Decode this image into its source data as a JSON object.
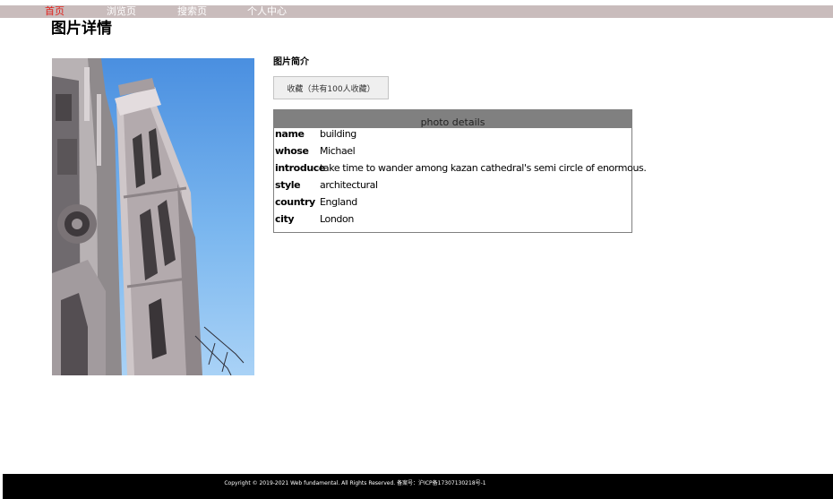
{
  "nav": {
    "items": [
      {
        "label": "首页",
        "active": true
      },
      {
        "label": "浏览页",
        "active": false
      },
      {
        "label": "搜索页",
        "active": false
      },
      {
        "label": "个人中心",
        "active": false
      }
    ]
  },
  "page": {
    "title": "图片详情"
  },
  "photo": {
    "subject": "building"
  },
  "info": {
    "heading": "图片简介",
    "favorite_button": "收藏（共有100人收藏）"
  },
  "details": {
    "header": "photo details",
    "rows": [
      {
        "key": "name",
        "value": "building"
      },
      {
        "key": "whose",
        "value": "Michael"
      },
      {
        "key": "introduce",
        "value": "take time to wander among kazan cathedral's semi circle of enormous."
      },
      {
        "key": "style",
        "value": "architectural"
      },
      {
        "key": "country",
        "value": "England"
      },
      {
        "key": "city",
        "value": "London"
      }
    ]
  },
  "footer": {
    "text": "Copyright © 2019-2021 Web fundamental. All Rights Reserved. 备案号：沪ICP备17307130218号-1"
  },
  "colors": {
    "nav_bg": "#c9bcbc",
    "nav_active": "#e0201b",
    "details_header_bg": "#808080",
    "footer_bg": "#000000"
  }
}
